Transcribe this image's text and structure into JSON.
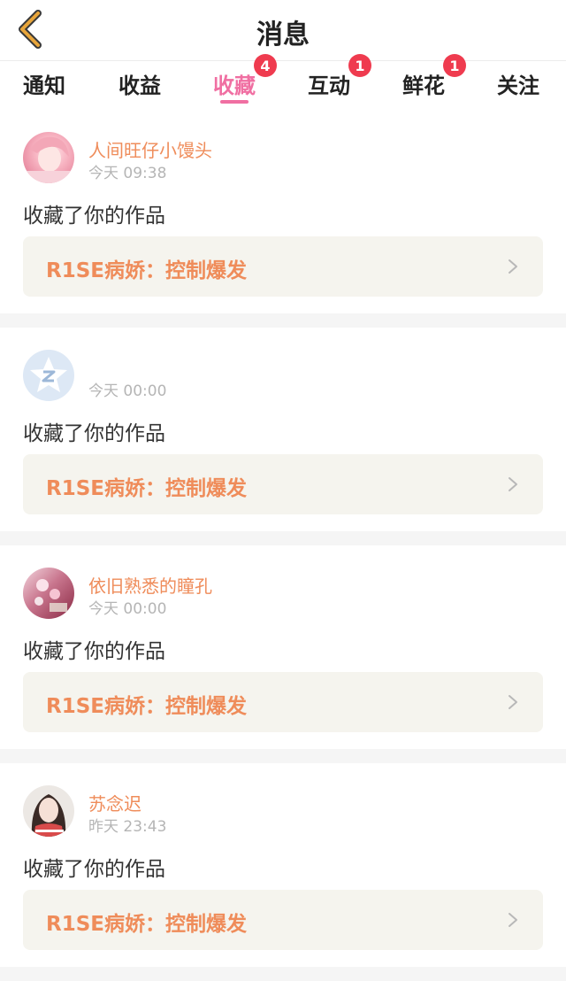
{
  "header": {
    "title": "消息"
  },
  "tabs": [
    {
      "label": "通知",
      "badge": ""
    },
    {
      "label": "收益",
      "badge": ""
    },
    {
      "label": "收藏",
      "badge": "4"
    },
    {
      "label": "互动",
      "badge": "1"
    },
    {
      "label": "鲜花",
      "badge": "1"
    },
    {
      "label": "关注",
      "badge": ""
    }
  ],
  "active_tab_index": 2,
  "items": [
    {
      "user": "人间旺仔小馒头",
      "time": "今天 09:38",
      "action": "收藏了你的作品",
      "work": "R1SE病娇：控制爆发",
      "avatar": "pink-hair-avatar"
    },
    {
      "user": "",
      "time": "今天 00:00",
      "action": "收藏了你的作品",
      "work": "R1SE病娇：控制爆发",
      "avatar": "default-qq-avatar"
    },
    {
      "user": "依旧熟悉的瞳孔",
      "time": "今天 00:00",
      "action": "收藏了你的作品",
      "work": "R1SE病娇：控制爆发",
      "avatar": "flower-avatar"
    },
    {
      "user": "苏念迟",
      "time": "昨天 23:43",
      "action": "收藏了你的作品",
      "work": "R1SE病娇：控制爆发",
      "avatar": "girl-portrait-avatar"
    }
  ],
  "colors": {
    "accent": "#f06fa2",
    "badge": "#ef3b4f",
    "username": "#ef8c5a",
    "back_icon": "#e8a53a"
  }
}
